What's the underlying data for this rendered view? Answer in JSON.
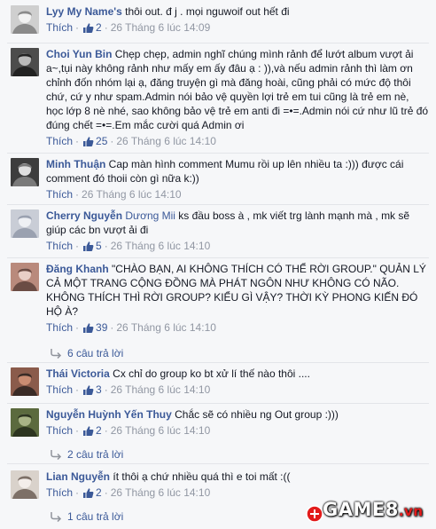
{
  "colors": {
    "link": "#3b5998",
    "muted": "#9197a3",
    "text": "#141823",
    "background": "#f6f7f9"
  },
  "comments": [
    {
      "author": "Lyy My Name's",
      "tagged": "",
      "text": "thôi out. đ j . mọi nguwoif out hết đi",
      "like_label": "Thích",
      "likes": "2",
      "time": "26 Tháng 6 lúc 14:09",
      "replies": ""
    },
    {
      "author": "Choi Yun Bin",
      "tagged": "",
      "text": "Chẹp chẹp, admin nghĩ chúng mình rảnh để lướt album vượt ải a~,tụi này không rảnh như mấy em ấy đâu ạ : )),và nếu admin rảnh thì làm ơn chỉnh đốn nhóm lại ạ, đăng truyện gì mà đăng hoài, cũng phải có mức độ thôi chứ, cứ y như spam.Admin nói bảo vệ quyền lợi trẻ em tui cũng là trẻ em nè, học lớp 8 nè nhé, sao không bảo vệ trẻ em anti đi =•=.Admin nói cứ như lũ trẻ đó đúng chết =•=.Em mắc cười quá Admin ơi",
      "like_label": "Thích",
      "likes": "25",
      "time": "26 Tháng 6 lúc 14:10",
      "replies": ""
    },
    {
      "author": "Minh Thuận",
      "tagged": "",
      "text": "Cap màn hình comment Mumu rồi up lên nhiều ta :))) được cái comment đó thoii còn gì nữa k:))",
      "like_label": "Thích",
      "likes": "",
      "time": "26 Tháng 6 lúc 14:10",
      "replies": ""
    },
    {
      "author": "Cherry Nguyễn",
      "tagged": "Dương Mii",
      "text": "ks đầu boss à , mk viết trg lành mạnh mà , mk sẽ giúp các bn vượt ải đi",
      "like_label": "Thích",
      "likes": "5",
      "time": "26 Tháng 6 lúc 14:10",
      "replies": ""
    },
    {
      "author": "Đăng Khanh",
      "tagged": "",
      "text": "\"CHÀO BẠN, AI KHÔNG THÍCH CÓ THỂ RỜI GROUP.\" QUẢN LÝ CẢ MỘT TRANG CỘNG ĐỒNG MÀ PHÁT NGÔN NHƯ KHÔNG CÓ NÃO. KHÔNG THÍCH THÌ RỜI GROUP? KIỂU GÌ VẬY? THỜI KỲ PHONG KIẾN ĐÓ HỘ À?",
      "like_label": "Thích",
      "likes": "39",
      "time": "26 Tháng 6 lúc 14:10",
      "replies": "6 câu trả lời"
    },
    {
      "author": "Thái Victoria",
      "tagged": "",
      "text": "Cx chỉ do group ko bt xử lí thế nào thôi ....",
      "like_label": "Thích",
      "likes": "3",
      "time": "26 Tháng 6 lúc 14:10",
      "replies": ""
    },
    {
      "author": "Nguyễn Huỳnh Yến Thuy",
      "tagged": "",
      "text": "Chắc sẽ có nhiều ng Out group :)))",
      "like_label": "Thích",
      "likes": "2",
      "time": "26 Tháng 6 lúc 14:10",
      "replies": "2 câu trả lời"
    },
    {
      "author": "Lian Nguyễn",
      "tagged": "",
      "text": "ít thôi ạ chứ nhiều quá thì e toi mất :((",
      "like_label": "Thích",
      "likes": "2",
      "time": "26 Tháng 6 lúc 14:10",
      "replies": "1 câu trả lời"
    }
  ],
  "watermark": {
    "main": "GAME",
    "digit": "8",
    "suffix": ".vn"
  }
}
